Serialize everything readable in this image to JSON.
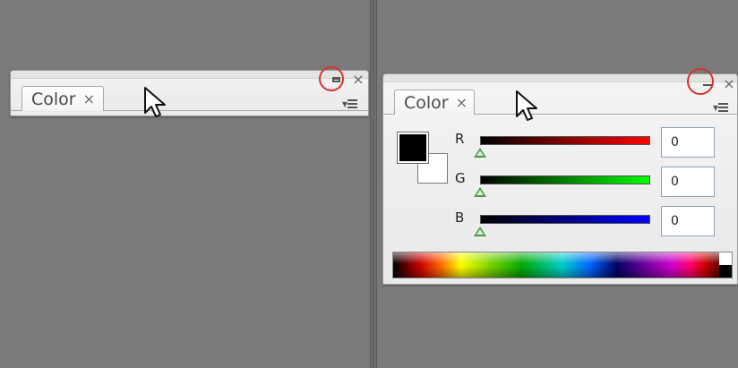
{
  "collapsed_panel": {
    "tab_label": "Color",
    "tab_close_glyph": "×",
    "close_glyph": "×",
    "restore_icon": "restore-icon",
    "menu_icon": "panel-menu-icon"
  },
  "expanded_panel": {
    "tab_label": "Color",
    "tab_close_glyph": "×",
    "close_glyph": "×",
    "minimize_icon": "minimize-icon",
    "menu_icon": "panel-menu-icon",
    "fill_swatch_color": "#000000",
    "stroke_swatch_color": "#ffffff",
    "channels": [
      {
        "label": "R",
        "value": "0",
        "level": 0,
        "color": "#ff0000"
      },
      {
        "label": "G",
        "value": "0",
        "level": 0,
        "color": "#00ff00"
      },
      {
        "label": "B",
        "value": "0",
        "level": 0,
        "color": "#0000ff"
      }
    ]
  },
  "highlight_color": "#d9322b"
}
